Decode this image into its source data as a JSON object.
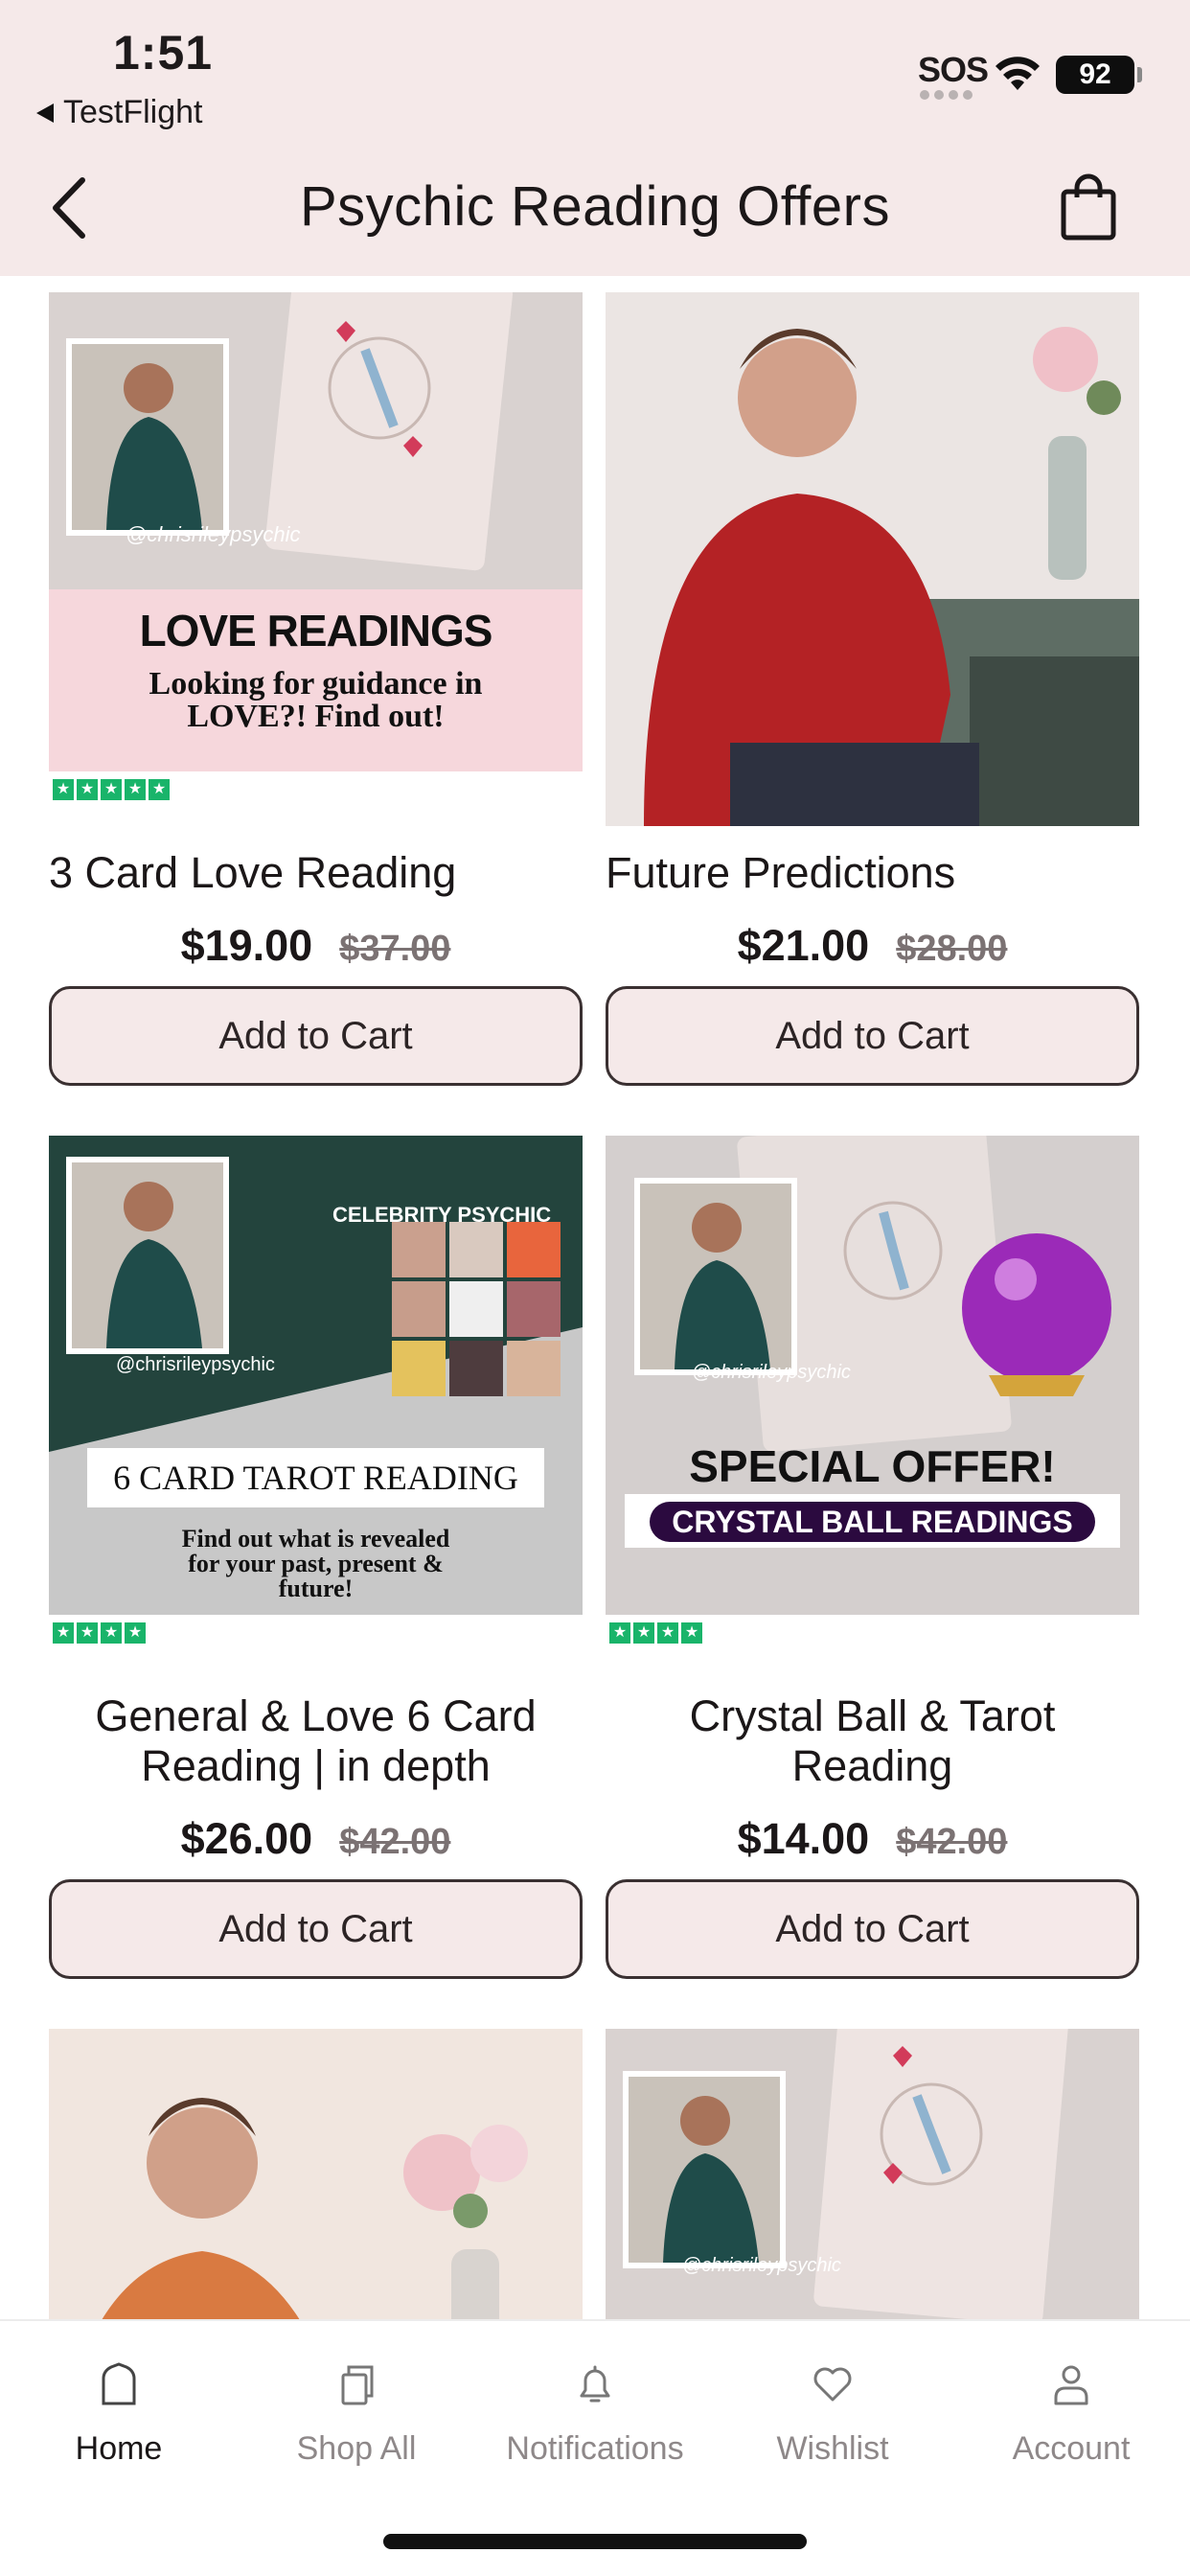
{
  "status_bar": {
    "time": "1:51",
    "back_app": "TestFlight",
    "carrier": "SOS",
    "battery": "92"
  },
  "header": {
    "title": "Psychic Reading Offers",
    "back_icon": "chevron-left-icon",
    "cart_icon": "shopping-bag-icon"
  },
  "products": [
    {
      "name": "3 Card Love Reading",
      "price": "$19.00",
      "compare_price": "$37.00",
      "button": "Add to Cart",
      "banner_title": "LOVE READINGS",
      "banner_sub": "Looking for guidance in LOVE?! Find out!",
      "watermark": "@chrisrileypsychic"
    },
    {
      "name": "Future Predictions",
      "price": "$21.00",
      "compare_price": "$28.00",
      "button": "Add to Cart"
    },
    {
      "name": "General & Love 6 Card Reading | in depth",
      "price": "$26.00",
      "compare_price": "$42.00",
      "button": "Add to Cart",
      "banner_tag": "CELEBRITY PSYCHIC",
      "banner_title": "6 CARD TAROT READING",
      "banner_sub": "Find out what is revealed for your past, present & future!",
      "watermark": "@chrisrileypsychic"
    },
    {
      "name": "Crystal Ball & Tarot Reading",
      "price": "$14.00",
      "compare_price": "$42.00",
      "button": "Add to Cart",
      "banner_title": "SPECIAL OFFER!",
      "banner_sub": "CRYSTAL BALL READINGS",
      "watermark": "@chrisrileypsychic"
    },
    {
      "name": "",
      "price": "",
      "compare_price": "",
      "button": ""
    },
    {
      "name": "",
      "price": "",
      "compare_price": "",
      "button": "",
      "watermark": "@chrisrileypsychic"
    }
  ],
  "tabs": [
    {
      "label": "Home",
      "icon": "home-icon",
      "active": true
    },
    {
      "label": "Shop All",
      "icon": "copy-icon"
    },
    {
      "label": "Notifications",
      "icon": "bell-icon"
    },
    {
      "label": "Wishlist",
      "icon": "heart-icon"
    },
    {
      "label": "Account",
      "icon": "user-icon"
    }
  ],
  "colors": {
    "header_bg": "#f5e9e9",
    "button_bg": "#f5e9e9",
    "button_border": "#3a3031",
    "text": "#1b1718",
    "muted": "#8e8889"
  }
}
